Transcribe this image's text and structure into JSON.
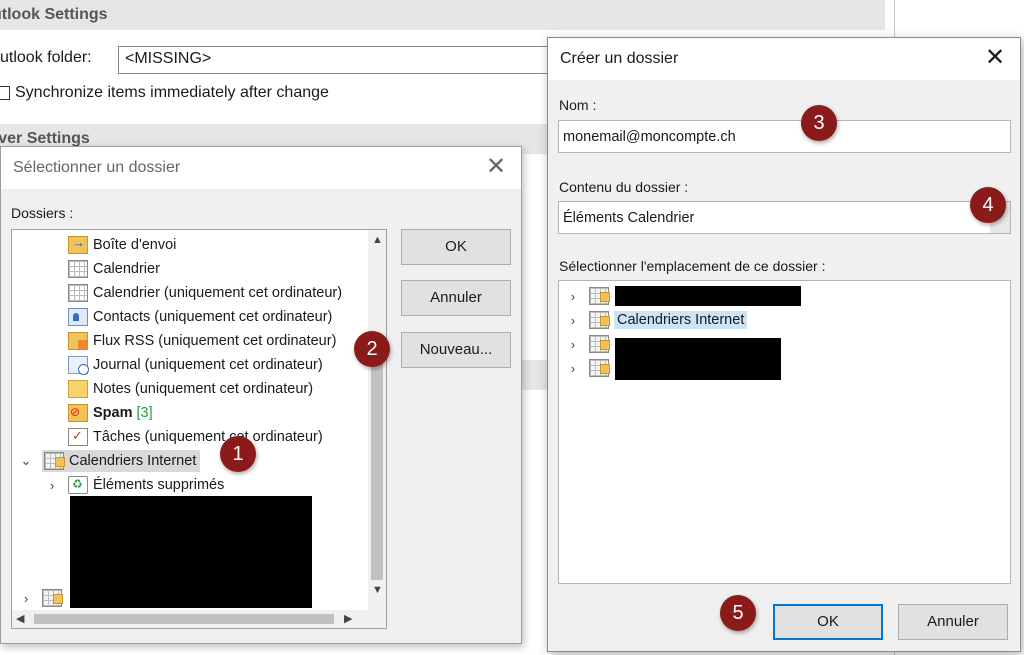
{
  "background": {
    "outlook_settings_header": "utlook Settings",
    "outlook_folder_label": "utlook folder:",
    "outlook_folder_value": "<MISSING>",
    "sync_label": "Synchronize items immediately after change",
    "server_settings_header": "rver Settings"
  },
  "select_dialog": {
    "title": "Sélectionner un dossier",
    "close_glyph": "✕",
    "dossiers_label": "Dossiers :",
    "folders": [
      {
        "label": "Boîte d'envoi",
        "icon": "outbox-icon"
      },
      {
        "label": "Calendrier",
        "icon": "calendar-icon"
      },
      {
        "label": "Calendrier (uniquement cet ordinateur)",
        "icon": "calendar-icon"
      },
      {
        "label": "Contacts (uniquement cet ordinateur)",
        "icon": "contacts-icon"
      },
      {
        "label": "Flux RSS (uniquement cet ordinateur)",
        "icon": "rss-icon"
      },
      {
        "label": "Journal (uniquement cet ordinateur)",
        "icon": "journal-icon"
      },
      {
        "label": "Notes (uniquement cet ordinateur)",
        "icon": "notes-icon"
      },
      {
        "label": "Spam",
        "count": "[3]",
        "icon": "spam-icon"
      },
      {
        "label": "Tâches (uniquement cet ordinateur)",
        "icon": "tasks-icon"
      },
      {
        "label": "Calendriers Internet",
        "icon": "internet-calendar-icon",
        "expanded": true,
        "selected": true
      },
      {
        "label": "Éléments supprimés",
        "icon": "trash-icon"
      }
    ],
    "ok_label": "OK",
    "cancel_label": "Annuler",
    "new_label": "Nouveau..."
  },
  "create_dialog": {
    "title": "Créer un dossier",
    "close_glyph": "✕",
    "name_label": "Nom :",
    "name_value": "monemail@moncompte.ch",
    "content_label": "Contenu du dossier :",
    "content_value": "Éléments Calendrier",
    "location_label": "Sélectionner l'emplacement de ce dossier :",
    "locations": [
      {
        "label": "",
        "redacted": true
      },
      {
        "label": "Calendriers Internet",
        "selected": true
      },
      {
        "label": "",
        "redacted": true
      },
      {
        "label": "",
        "redacted": true
      }
    ],
    "ok_label": "OK",
    "cancel_label": "Annuler"
  },
  "markers": [
    "1",
    "2",
    "3",
    "4",
    "5"
  ],
  "colors": {
    "marker_bg": "#8b1a1a",
    "selection_bg": "#cce4f7",
    "default_button_border": "#0078d7",
    "dialog_bg": "#f0f0f0"
  }
}
